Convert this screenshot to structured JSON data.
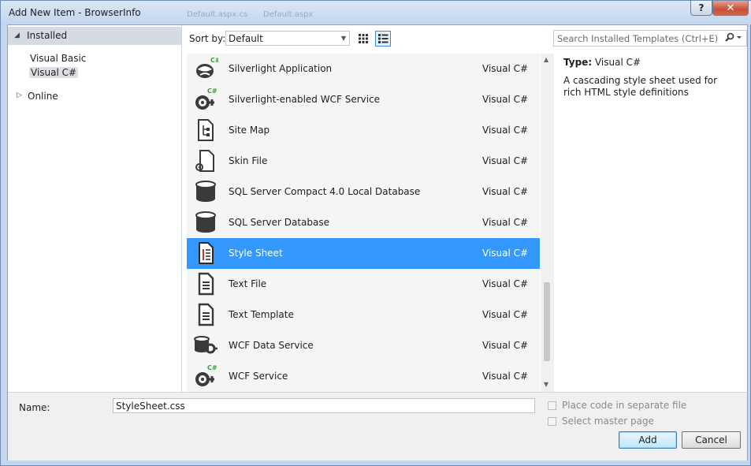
{
  "window": {
    "title": "Add New Item - BrowserInfo",
    "help_glyph": "?",
    "close_glyph": "✕",
    "background_tabs": [
      "Default.aspx.cs",
      "Default.aspx"
    ]
  },
  "tree": {
    "installed": "Installed",
    "items": [
      "Visual Basic",
      "Visual C#"
    ],
    "selected": "Visual C#",
    "online": "Online"
  },
  "toolbar": {
    "sort_label": "Sort by:",
    "sort_value": "Default",
    "search_placeholder": "Search Installed Templates (Ctrl+E)"
  },
  "templates": [
    {
      "name": "Silverlight Application",
      "lang": "Visual C#",
      "icon": "silverlight-app-icon"
    },
    {
      "name": "Silverlight-enabled WCF Service",
      "lang": "Visual C#",
      "icon": "wcf-service-icon"
    },
    {
      "name": "Site Map",
      "lang": "Visual C#",
      "icon": "sitemap-icon"
    },
    {
      "name": "Skin File",
      "lang": "Visual C#",
      "icon": "skin-file-icon"
    },
    {
      "name": "SQL Server Compact 4.0 Local Database",
      "lang": "Visual C#",
      "icon": "database-icon"
    },
    {
      "name": "SQL Server Database",
      "lang": "Visual C#",
      "icon": "database-icon"
    },
    {
      "name": "Style Sheet",
      "lang": "Visual C#",
      "icon": "style-sheet-icon",
      "selected": true
    },
    {
      "name": "Text File",
      "lang": "Visual C#",
      "icon": "text-file-icon"
    },
    {
      "name": "Text Template",
      "lang": "Visual C#",
      "icon": "text-template-icon"
    },
    {
      "name": "WCF Data Service",
      "lang": "Visual C#",
      "icon": "wcf-data-service-icon"
    },
    {
      "name": "WCF Service",
      "lang": "Visual C#",
      "icon": "wcf-service-icon"
    }
  ],
  "details": {
    "type_label": "Type:",
    "type_value": "Visual C#",
    "description": "A cascading style sheet used for rich HTML style definitions"
  },
  "bottom": {
    "name_label": "Name:",
    "name_value": "StyleSheet.css",
    "option_separate": "Place code in separate file",
    "option_master": "Select master page",
    "add_label": "Add",
    "cancel_label": "Cancel"
  },
  "colors": {
    "selection": "#3399ff",
    "list_bg": "#f5f5f5",
    "frame": "#c4d7ee"
  }
}
